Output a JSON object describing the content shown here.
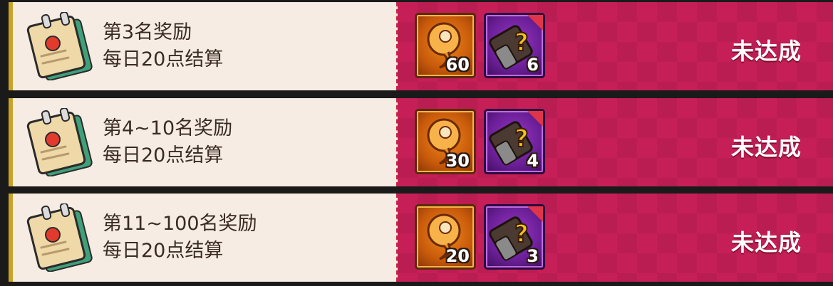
{
  "rows": [
    {
      "title": "第3名奖励",
      "subtitle": "每日20点结算",
      "rewards": [
        {
          "icon": "orange-spiral-item-icon",
          "quantity": "60"
        },
        {
          "icon": "mystery-scroll-item-icon",
          "quantity": "6"
        }
      ],
      "status": "未达成"
    },
    {
      "title": "第4~10名奖励",
      "subtitle": "每日20点结算",
      "rewards": [
        {
          "icon": "orange-spiral-item-icon",
          "quantity": "30"
        },
        {
          "icon": "mystery-scroll-item-icon",
          "quantity": "4"
        }
      ],
      "status": "未达成"
    },
    {
      "title": "第11~100名奖励",
      "subtitle": "每日20点结算",
      "rewards": [
        {
          "icon": "orange-spiral-item-icon",
          "quantity": "20"
        },
        {
          "icon": "mystery-scroll-item-icon",
          "quantity": "3"
        }
      ],
      "status": "未达成"
    }
  ],
  "colors": {
    "left_panel": "#f6ece3",
    "right_panel": "#c61f57",
    "text": "#3a2b22",
    "orange_frame": "#c85a0b",
    "purple_frame": "#6a1f96"
  }
}
